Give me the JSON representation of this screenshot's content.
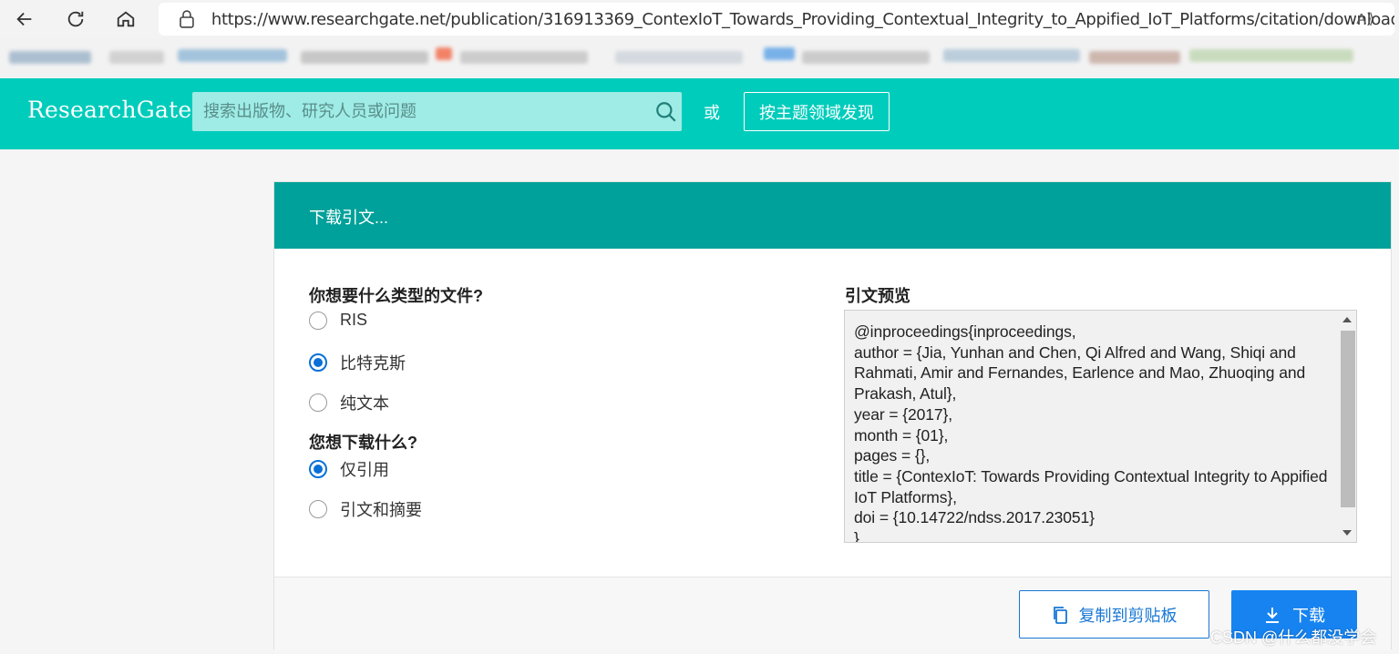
{
  "browser": {
    "url": "https://www.researchgate.net/publication/316913369_ContexIoT_Towards_Providing_Contextual_Integrity_to_Appified_IoT_Platforms/citation/download",
    "icons": [
      "back-icon",
      "refresh-icon",
      "home-icon",
      "lock-icon",
      "read-aloud-icon"
    ]
  },
  "header": {
    "logo": "ResearchGate",
    "search_placeholder": "搜索出版物、研究人员或问题",
    "or_text": "或",
    "discover_label": "按主题领域发现",
    "accent_color": "#00ccbb"
  },
  "dialog": {
    "title": "下载引文...",
    "file_type_question": "你想要什么类型的文件?",
    "file_types": [
      {
        "label": "RIS",
        "checked": false
      },
      {
        "label": "比特克斯",
        "checked": true
      },
      {
        "label": "纯文本",
        "checked": false
      }
    ],
    "download_question": "您想下载什么?",
    "download_options": [
      {
        "label": "仅引用",
        "checked": true
      },
      {
        "label": "引文和摘要",
        "checked": false
      }
    ],
    "preview_label": "引文预览",
    "preview_text": "@inproceedings{inproceedings,\nauthor = {Jia, Yunhan and Chen, Qi Alfred and Wang, Shiqi and Rahmati, Amir and Fernandes, Earlence and Mao, Zhuoqing and Prakash, Atul},\nyear = {2017},\nmonth = {01},\npages = {},\ntitle = {ContexIoT: Towards Providing Contextual Integrity to Appified IoT Platforms},\ndoi = {10.14722/ndss.2017.23051}\n}",
    "copy_label": "复制到剪贴板",
    "download_label": "下载"
  },
  "watermark": "CSDN @什么都没学会"
}
